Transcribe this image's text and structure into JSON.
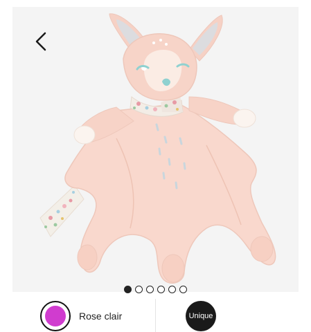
{
  "gallery": {
    "image_subject": "pink fawn baby comforter with floral ribbon tags",
    "page_count": 6,
    "active_index": 0
  },
  "navigation": {
    "back_icon": "chevron-left-icon"
  },
  "colors": {
    "background": "#f4f4f4",
    "plush_body": "#f9d8cd",
    "plush_shadow": "#edc2b4",
    "muzzle": "#fbece4",
    "eye_nose": "#8fd1d0",
    "ear_inner": "#d9d9dc",
    "swatch_rose": "#d03ccf",
    "chip_dark": "#1a1a1a"
  },
  "options": {
    "color": {
      "label": "Rose clair",
      "swatch_color": "#d03ccf",
      "selected": true
    },
    "size": {
      "label": "Unique",
      "selected": true
    }
  }
}
